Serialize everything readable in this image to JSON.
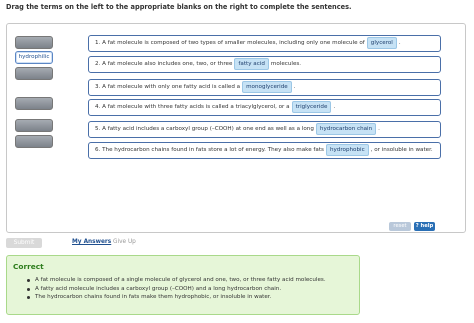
{
  "instructions": "Drag the terms on the left to the appropriate blanks on the right to complete the sentences.",
  "bank": {
    "placed_term": "hydrophilic"
  },
  "sentences": [
    {
      "before": "1. A fat molecule is composed of two types of smaller molecules, including only one molecule of",
      "blank": "glycerol",
      "after": "."
    },
    {
      "before": "2. A fat molecule also includes one, two, or three",
      "blank": "fatty acid",
      "after": "molecules."
    },
    {
      "before": "3. A fat molecule with only one fatty acid is called a",
      "blank": "monoglyceride",
      "after": "."
    },
    {
      "before": "4. A fat molecule with three fatty acids is called a triacylglycerol, or a",
      "blank": "triglyceride",
      "after": "."
    },
    {
      "before": "5. A fatty acid includes a carboxyl group (–COOH) at one end as well as a long",
      "blank": "hydrocarbon chain",
      "after": "."
    },
    {
      "before": "6. The hydrocarbon chains found in fats store a lot of energy. They also make fats",
      "blank": "hydrophobic",
      "after": ", or insoluble in water."
    }
  ],
  "buttons": {
    "reset": "reset",
    "help": "? help",
    "submit": "Submit"
  },
  "links": {
    "my_answers": "My Answers",
    "give_up": "Give Up"
  },
  "feedback": {
    "title": "Correct",
    "items": [
      "A fat molecule is composed of a single molecule of glycerol and one, two, or three fatty acid molecules.",
      "A fatty acid molecule includes a carboxyl group (–COOH) and a long hydrocarbon chain.",
      "The hydrocarbon chains found in fats make them hydrophobic, or insoluble in water."
    ]
  },
  "colors": {
    "accent": "#4a6fa8",
    "blank_fill": "#c6e2f5",
    "correct_bg": "#e6f6d8",
    "correct_title": "#2e7d1d"
  }
}
